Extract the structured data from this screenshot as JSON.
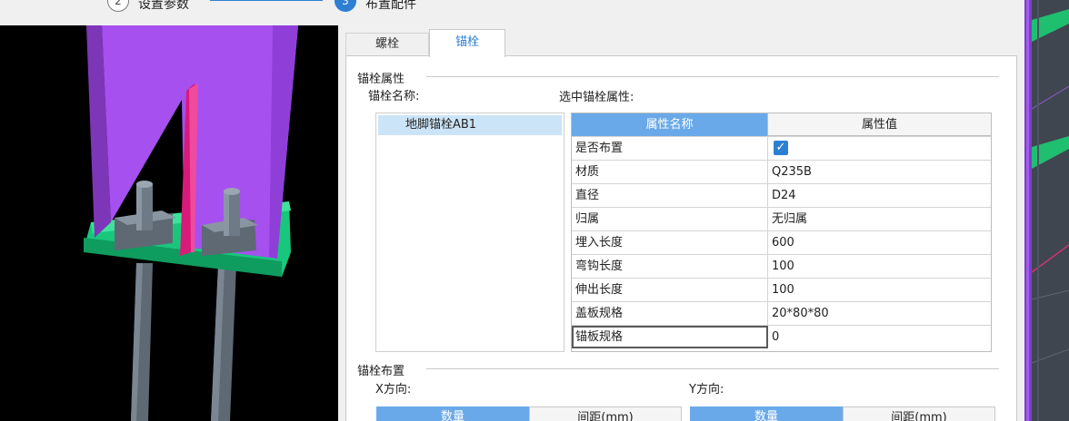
{
  "wizard": {
    "step2_number": "2",
    "step2_label": "设置参数",
    "step3_number": "3",
    "step3_label": "布置配件"
  },
  "tabs": [
    {
      "label": "螺栓"
    },
    {
      "label": "锚栓"
    }
  ],
  "anchor_properties": {
    "group_title": "锚栓属性",
    "name_label": "锚栓名称:",
    "selected_label": "选中锚栓属性:",
    "anchor_list": [
      "地脚锚栓AB1"
    ],
    "table_headers": [
      "属性名称",
      "属性值"
    ],
    "rows": [
      {
        "name": "是否布置",
        "value": "",
        "checked": true
      },
      {
        "name": "材质",
        "value": "Q235B"
      },
      {
        "name": "直径",
        "value": "D24"
      },
      {
        "name": "归属",
        "value": "无归属"
      },
      {
        "name": "埋入长度",
        "value": "600"
      },
      {
        "name": "弯钩长度",
        "value": "100"
      },
      {
        "name": "伸出长度",
        "value": "100"
      },
      {
        "name": "盖板规格",
        "value": "20*80*80"
      },
      {
        "name": "锚板规格",
        "value": "0"
      }
    ]
  },
  "anchor_layout": {
    "group_title": "锚栓布置",
    "x_label": "X方向:",
    "y_label": "Y方向:",
    "x_headers": [
      "数量",
      "间距(mm)"
    ],
    "y_headers": [
      "数量",
      "间距(mm)"
    ]
  },
  "colors": {
    "accent": "#2d7fd3",
    "column": "#a650f0",
    "base_plate": "#19c77c",
    "stiffener": "#d81b7a",
    "bolt": "#6e7a85"
  }
}
